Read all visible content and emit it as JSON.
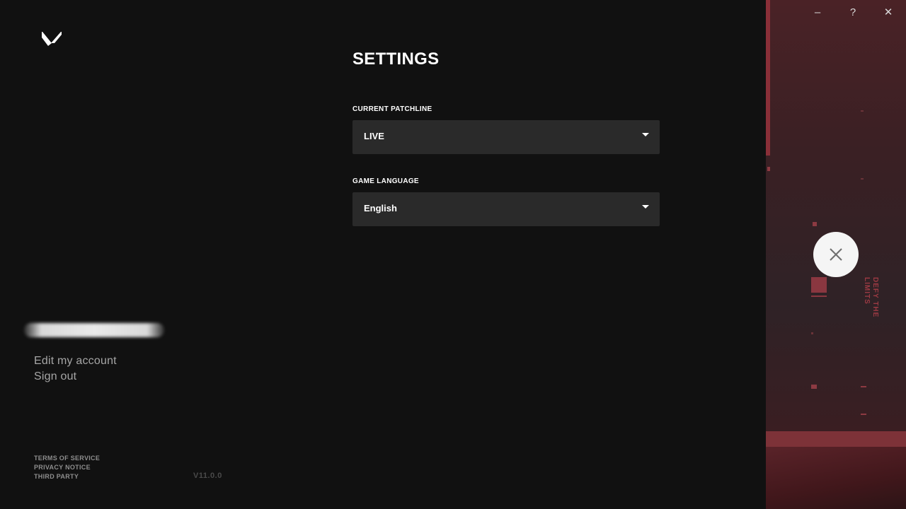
{
  "app": {
    "logo_icon": "valorant-logo-icon"
  },
  "settings": {
    "title": "SETTINGS",
    "patchline": {
      "label": "CURRENT PATCHLINE",
      "value": "LIVE"
    },
    "language": {
      "label": "GAME LANGUAGE",
      "value": "English"
    }
  },
  "account": {
    "edit_label": "Edit my account",
    "signout_label": "Sign out"
  },
  "legal": {
    "terms": "TERMS OF SERVICE",
    "privacy": "PRIVACY NOTICE",
    "third_party": "THIRD PARTY"
  },
  "version": "V11.0.0",
  "window": {
    "minimize_glyph": "–",
    "help_glyph": "?",
    "close_glyph": "✕"
  },
  "art": {
    "tagline": "DEFY THE LIMITS"
  },
  "colors": {
    "background": "#111111",
    "select_bg": "#2a2a2a",
    "accent_red": "#8a2f38"
  }
}
